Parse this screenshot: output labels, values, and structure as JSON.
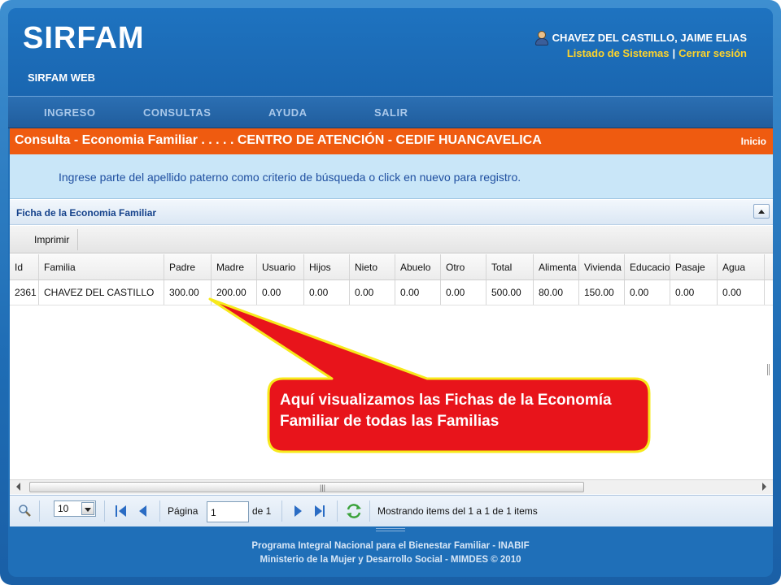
{
  "header": {
    "logo": "SIRFAM",
    "subtitle": "SIRFAM WEB",
    "user_name": "CHAVEZ DEL CASTILLO, JAIME ELIAS",
    "link_systems": "Listado de Sistemas",
    "link_separator": "|",
    "link_logout": "Cerrar sesión"
  },
  "menu": [
    "INGRESO",
    "CONSULTAS",
    "AYUDA",
    "SALIR"
  ],
  "title_bar": {
    "title": "Consulta - Economia Familiar . . . . . CENTRO DE ATENCIÓN - CEDIF HUANCAVELICA",
    "home": "Inicio"
  },
  "info_text": "Ingrese parte del apellido paterno como criterio de búsqueda o click en nuevo para registro.",
  "panel": {
    "title": "Ficha de la Economia Familiar",
    "print_label": "Imprimir"
  },
  "grid": {
    "columns": [
      "Id",
      "Familia",
      "Padre",
      "Madre",
      "Usuario",
      "Hijos",
      "Nieto",
      "Abuelo",
      "Otro",
      "Total",
      "Alimenta",
      "Vivienda",
      "Educacio",
      "Pasaje",
      "Agua"
    ],
    "rows": [
      [
        "2361",
        "CHAVEZ DEL CASTILLO",
        "300.00",
        "200.00",
        "0.00",
        "0.00",
        "0.00",
        "0.00",
        "0.00",
        "500.00",
        "80.00",
        "150.00",
        "0.00",
        "0.00",
        "0.00"
      ]
    ]
  },
  "pager": {
    "page_size": "10",
    "page_label": "Página",
    "page_value": "1",
    "of_label": "de 1",
    "status": "Mostrando items del 1 a 1 de 1 items"
  },
  "footer": {
    "line1": "Programa Integral Nacional para el Bienestar Familiar - INABIF",
    "line2": "Ministerio de la Mujer y Desarrollo Social - MIMDES © 2010"
  },
  "callout": {
    "text": "Aquí visualizamos las Fichas de la Economía Familiar de todas las Familias",
    "fill": "#e8141b",
    "border": "#f7e91b"
  }
}
